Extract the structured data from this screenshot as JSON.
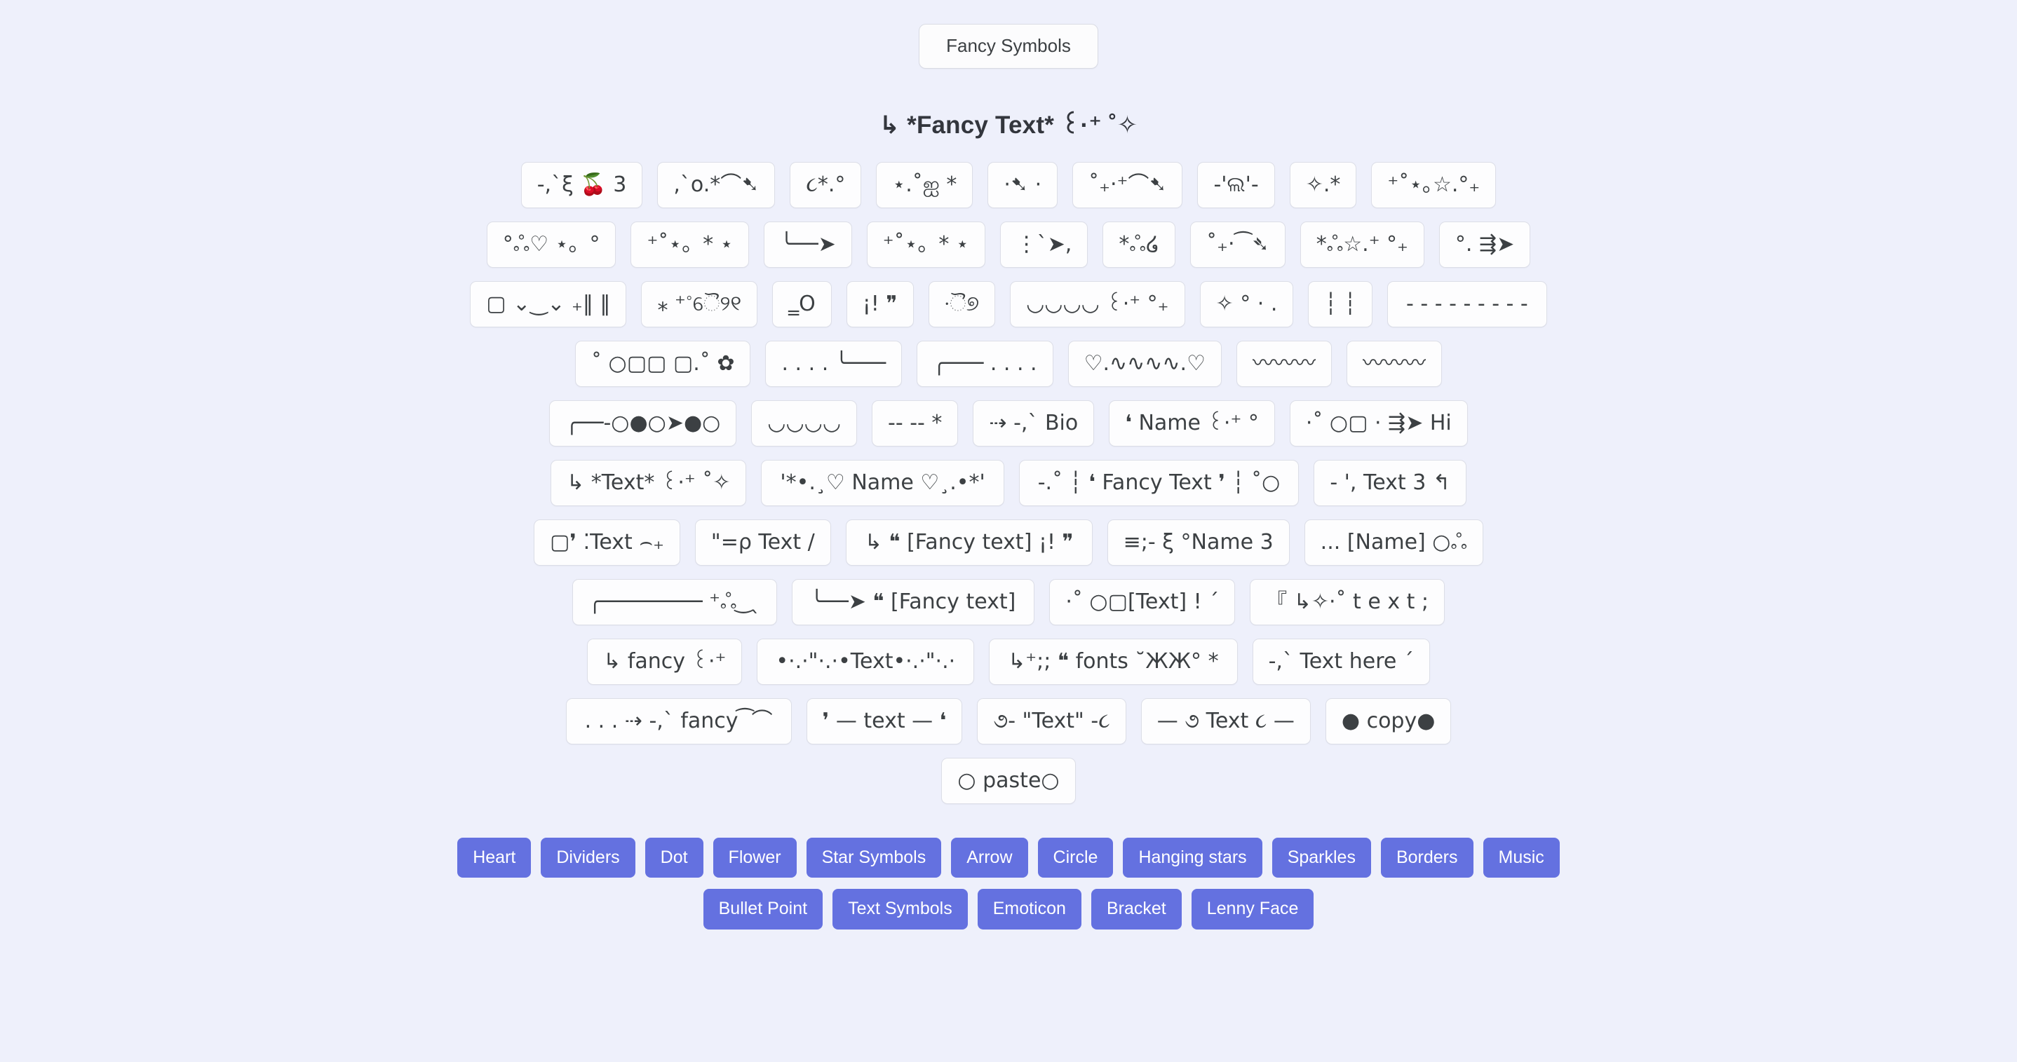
{
  "page": {
    "title_chip": "Fancy Symbols",
    "section_heading": "↳ *Fancy Text* ꒰·⁺ ˚✧",
    "accent_color": "#6471e0",
    "background_color": "#eef0fb",
    "chip_background": "#fdfdfe",
    "chip_border": "#dcdee7",
    "text_color": "#3c4043"
  },
  "symbol_rows": [
    {
      "items": [
        "-,`ξ 🍒 3",
        ",`o.*⌒➷",
        "૮*.°",
        "⋆.˚ஐ *",
        "·➷ ·",
        "˚₊‧⁺⌒➷",
        "-'ଲ'-",
        "✧.*",
        "⁺˚⋆｡☆.°₊"
      ]
    },
    {
      "items": [
        "°ஃ♡ ⋆。°",
        "⁺˚⋆。* ⋆",
        "╰──➤",
        "⁺˚⋆。* ⋆",
        "⋮`➤,",
        "*ஃ໒︎",
        "˚₊‧⁀➴",
        "*ஃ☆.⁺ °₊",
        "°. ⇶➤"
      ]
    },
    {
      "items": [
        "▢ ⌄‿⌄ ₊‖ ‖",
        "⁎ ⁺˚ୈ୨୧",
        "‗O",
        "¡! ❞",
        "·ୖ୭",
        "◡◡◡◡ ꒰·⁺ °₊",
        "✧ ° · .",
        "┆ ┆",
        "- - - - - - - - -"
      ]
    },
    {
      "items": [
        "˚ ○▢▢ ▢.˚ ✿",
        ". . . . ╰───",
        "╭─── . . . .",
        "♡.∿∿∿∿.♡",
        "〰〰〰",
        "〰〰〰"
      ]
    },
    {
      "items": [
        "╭──-○●○➤●○",
        "◡◡◡◡",
        "-- --\n*",
        "⇢ -,` Bio",
        "❛ Name ꒰·⁺ °",
        "·˚ ○▢ · ⇶➤ Hi"
      ]
    },
    {
      "items": [
        "↳ *Text* ꒰·⁺ ˚✧",
        "'*•.¸♡ Name ♡¸.•*'",
        "-.˚ ┆ ❛ Fancy Text ❜ ┆ ˚○",
        "- ', Text 3 ↰"
      ]
    },
    {
      "items": [
        "▢❜ ⁚Text ⌢₊",
        "\"=ρ Text /",
        "↳ ❝ [Fancy text] ¡! ❞",
        "≡;- ξ °Name 3",
        "... [Name] ○ஃ"
      ]
    },
    {
      "items": [
        "╭──────── ⁺ஃ ͜ ˎ",
        "╰──➤ ❝ [Fancy text]",
        "·˚ ○▢[Text] ! ˊ",
        "『 ↳✧·˚ t e x t ;"
      ]
    },
    {
      "items": [
        "↳ fancy ꒰·⁺",
        "•·.·\"·.·•Text•·.·\"·.·",
        "↳⁺;; ❝ fonts ˘ЖЖ° *",
        "-,` Text here ˊ"
      ]
    },
    {
      "items": [
        ". . . ⇢ -,` fancy ͡ ⌒",
        "❜ — text — ❛",
        "૭- \"Text\" -૮",
        "— ૭ Text ૮ —",
        "● copy●"
      ]
    },
    {
      "items": [
        "○ paste○"
      ]
    }
  ],
  "category_rows": [
    {
      "buttons": [
        "Heart",
        "Dividers",
        "Dot",
        "Flower",
        "Star Symbols",
        "Arrow",
        "Circle",
        "Hanging stars",
        "Sparkles",
        "Borders",
        "Music"
      ]
    },
    {
      "buttons": [
        "Bullet Point",
        "Text Symbols",
        "Emoticon",
        "Bracket",
        "Lenny Face"
      ]
    }
  ]
}
